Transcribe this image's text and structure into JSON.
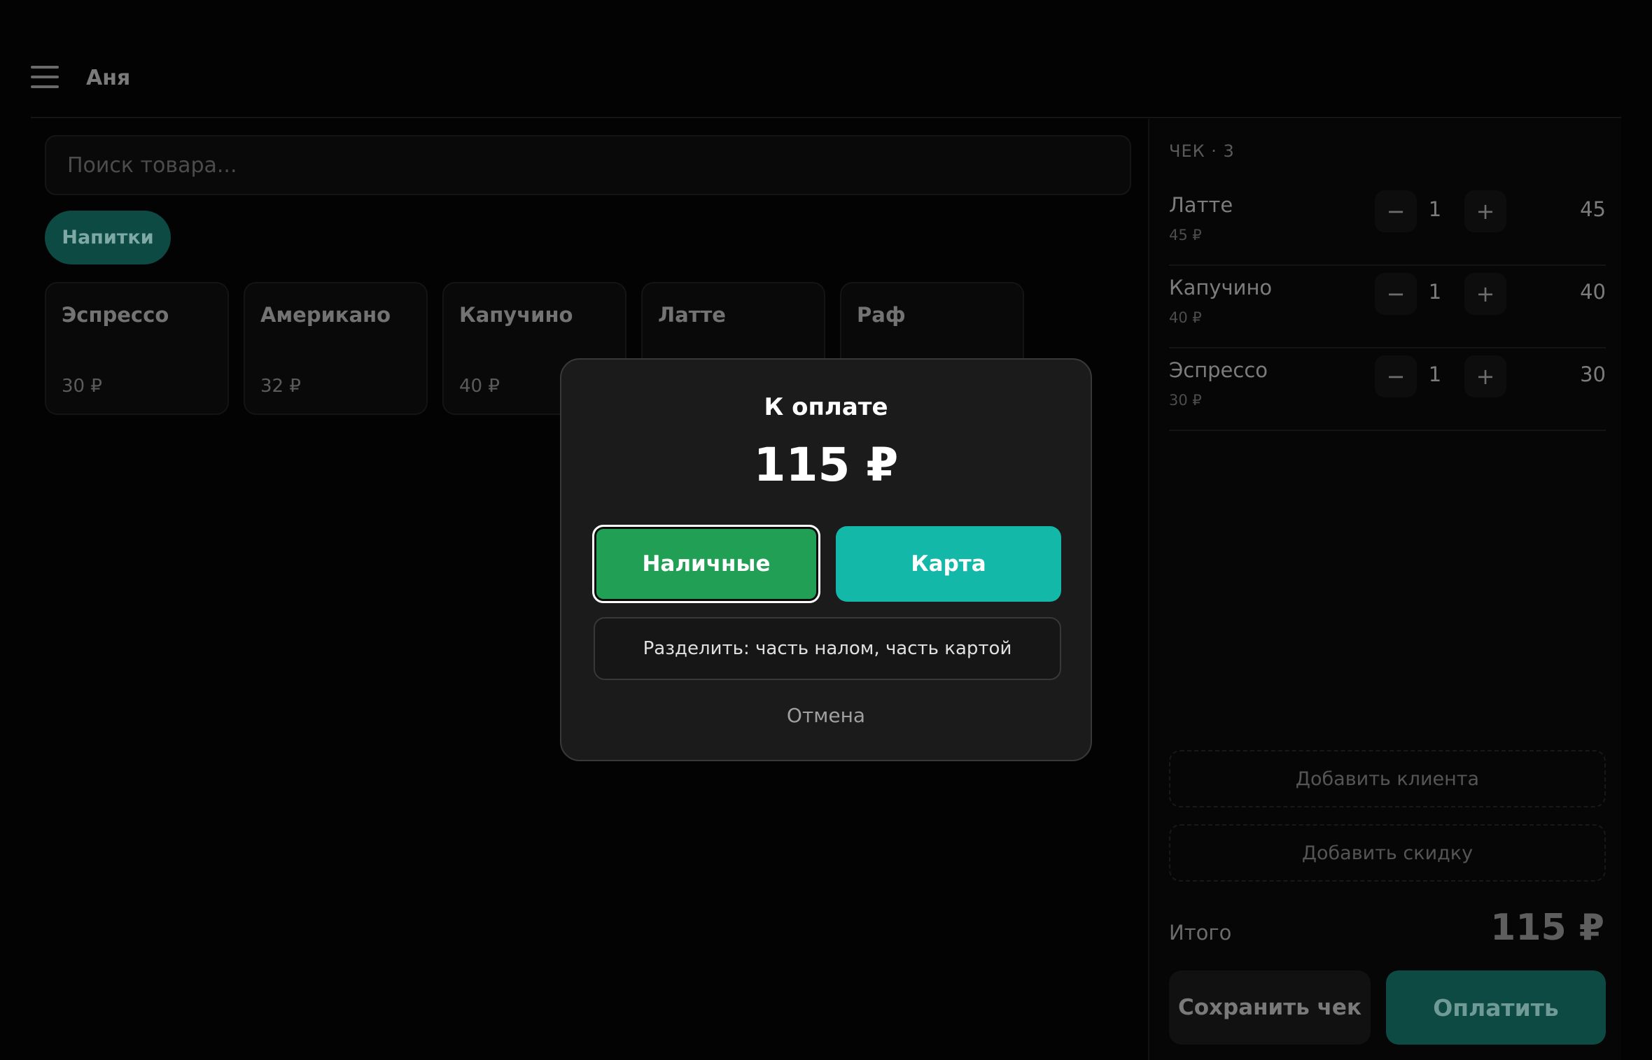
{
  "header": {
    "user_name": "Аня"
  },
  "search": {
    "placeholder": "Поиск товара..."
  },
  "categories": [
    {
      "label": "Напитки"
    }
  ],
  "products": [
    {
      "name": "Эспрессо",
      "price": "30 ₽"
    },
    {
      "name": "Американо",
      "price": "32 ₽"
    },
    {
      "name": "Капучино",
      "price": "40 ₽"
    },
    {
      "name": "Латте",
      "price": ""
    },
    {
      "name": "Раф",
      "price": ""
    }
  ],
  "receipt": {
    "title": "ЧЕК · 3",
    "lines": [
      {
        "name": "Латте",
        "unit_price": "45 ₽",
        "qty": "1",
        "total": "45"
      },
      {
        "name": "Капучино",
        "unit_price": "40 ₽",
        "qty": "1",
        "total": "40"
      },
      {
        "name": "Эспрессо",
        "unit_price": "30 ₽",
        "qty": "1",
        "total": "30"
      }
    ],
    "minus": "−",
    "plus": "+",
    "add_client": "Добавить клиента",
    "add_discount": "Добавить скидку",
    "total_label": "Итого",
    "total_value": "115 ₽",
    "save_label": "Сохранить чек",
    "pay_label": "Оплатить"
  },
  "modal": {
    "title": "К оплате",
    "amount": "115 ₽",
    "cash_label": "Наличные",
    "card_label": "Карта",
    "split_label": "Разделить: часть налом, часть картой",
    "cancel_label": "Отмена"
  },
  "colors": {
    "accent_teal": "#14b8a8",
    "cash_green": "#21a055",
    "modal_bg": "#1b1b1b",
    "app_bg": "#030303"
  },
  "icons": {
    "menu": "hamburger-menu-icon"
  }
}
